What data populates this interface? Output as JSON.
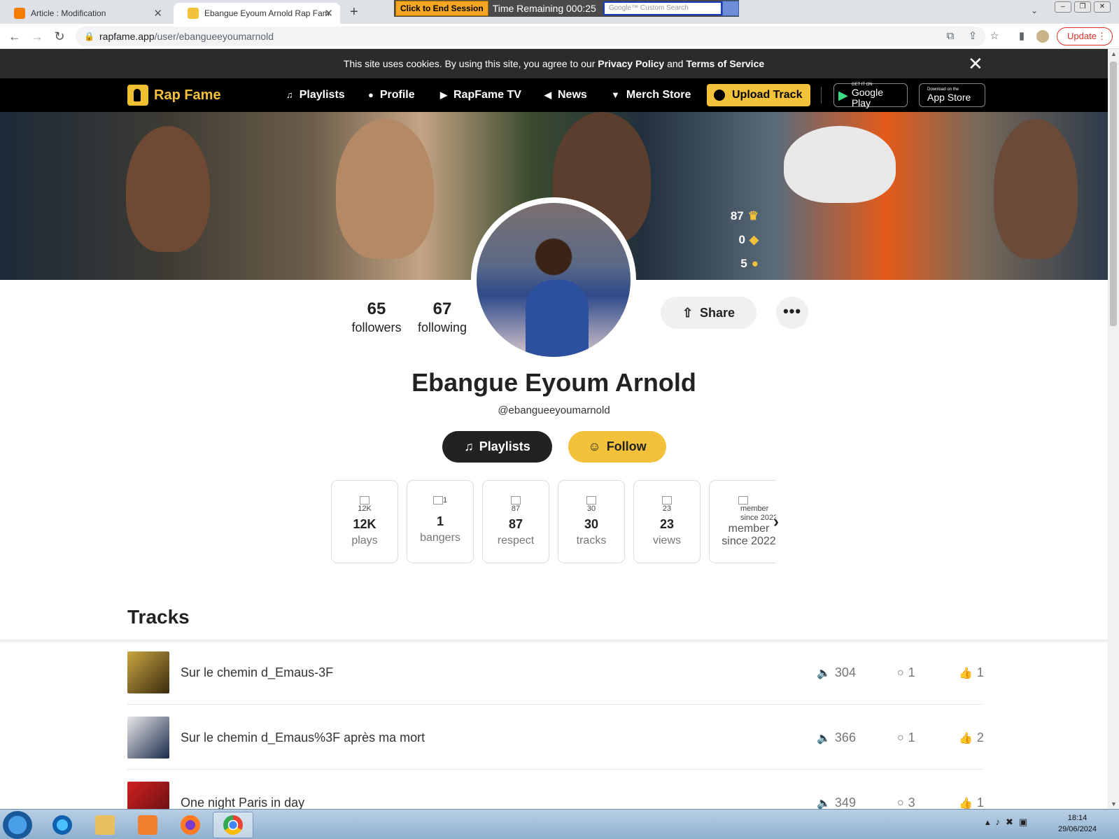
{
  "browser": {
    "tabs": [
      {
        "title": "Article : Modification",
        "favicon_color": "#f57c00"
      },
      {
        "title": "Ebangue Eyoum Arnold Rap Fam",
        "favicon_color": "#f3c13a"
      }
    ],
    "new_tab_symbol": "+",
    "kiosk": {
      "end_session_label": "Click to End Session",
      "time_remaining": "Time Remaining 000:25",
      "search_placeholder": "Google™ Custom Search"
    },
    "url_host": "rapfame.app",
    "url_path": "/user/ebangueeyoumarnold",
    "update_label": "Update"
  },
  "cookie_banner": {
    "text_before": "This site uses cookies. By using this site, you agree to our ",
    "privacy": "Privacy Policy",
    "and": " and ",
    "terms": "Terms of Service"
  },
  "nav": {
    "logo": "Rap Fame",
    "items": [
      {
        "label": "Playlists",
        "icon": "playlist-icon"
      },
      {
        "label": "Profile",
        "icon": "user-icon"
      },
      {
        "label": "RapFame TV",
        "icon": "tv-icon"
      },
      {
        "label": "News",
        "icon": "megaphone-icon"
      },
      {
        "label": "Merch Store",
        "icon": "shirt-icon"
      }
    ],
    "upload_label": "Upload Track",
    "google_play": {
      "small": "GET IT ON",
      "large": "Google Play"
    },
    "app_store": {
      "small": "Download on the",
      "large": "App Store"
    }
  },
  "profile": {
    "badges": {
      "respect": "87",
      "diamonds": "0",
      "coins": "5"
    },
    "followers_count": "65",
    "followers_label": "followers",
    "following_count": "67",
    "following_label": "following",
    "share_label": "Share",
    "name": "Ebangue Eyoum Arnold",
    "handle": "@ebangueeyoumarnold",
    "playlists_label": "Playlists",
    "follow_label": "Follow",
    "stat_cards": [
      {
        "alt": "12K",
        "value": "12K",
        "label": "plays"
      },
      {
        "alt": "1",
        "value": "1",
        "label": "bangers"
      },
      {
        "alt": "87",
        "value": "87",
        "label": "respect"
      },
      {
        "alt": "30",
        "value": "30",
        "label": "tracks"
      },
      {
        "alt": "23",
        "value": "23",
        "label": "views"
      },
      {
        "alt": "member since 2022",
        "value": "",
        "label": "member since 2022"
      }
    ]
  },
  "tracks_section": {
    "title": "Tracks",
    "items": [
      {
        "title": "Sur le chemin d_Emaus-3F",
        "plays": "304",
        "comments": "1",
        "likes": "1"
      },
      {
        "title": "Sur le chemin d_Emaus%3F après ma mort",
        "plays": "366",
        "comments": "1",
        "likes": "2"
      },
      {
        "title": "One night Paris in day",
        "plays": "349",
        "comments": "3",
        "likes": "1"
      }
    ]
  },
  "taskbar": {
    "time": "18:14",
    "date": "29/06/2024"
  }
}
